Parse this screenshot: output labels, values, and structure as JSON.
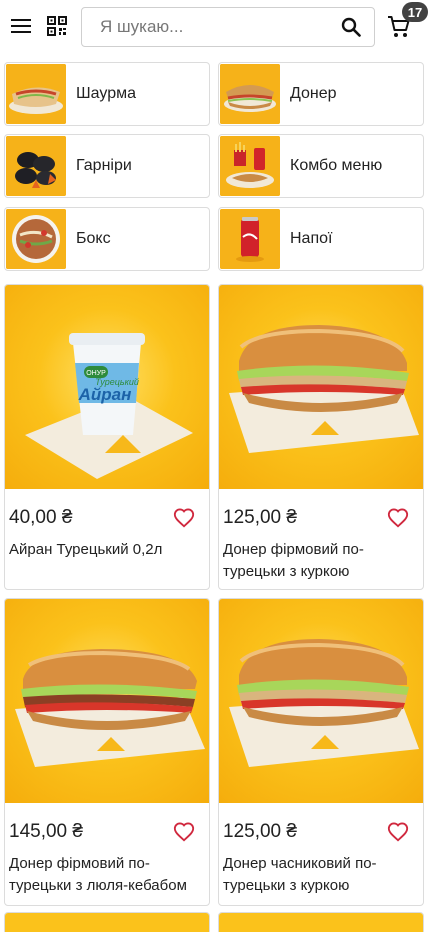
{
  "header": {
    "menu_icon": "menu-icon",
    "qr_icon": "qr-code-icon",
    "search_placeholder": "Я шукаю...",
    "search_icon": "search-icon",
    "cart_icon": "cart-icon",
    "cart_count": "17"
  },
  "categories": [
    {
      "label": "Шаурма",
      "icon": "shawarma"
    },
    {
      "label": "Донер",
      "icon": "doner"
    },
    {
      "label": "Гарніри",
      "icon": "garnish"
    },
    {
      "label": "Комбо меню",
      "icon": "combo"
    },
    {
      "label": "Бокс",
      "icon": "box"
    },
    {
      "label": "Напої",
      "icon": "drink"
    }
  ],
  "products": [
    {
      "price": "40,00 ₴",
      "name": "Айран Турецький 0,2л",
      "image": "ayran-cup",
      "cup_brand": "ОНУР",
      "cup_label": "Турецький",
      "cup_title": "Айран"
    },
    {
      "price": "125,00 ₴",
      "name": "Донер фірмовий по-турецьки з куркою",
      "image": "doner-sandwich"
    },
    {
      "price": "145,00 ₴",
      "name": "Донер фірмовий по-турецьки з люля-кебабом",
      "image": "doner-sandwich-kebab"
    },
    {
      "price": "125,00 ₴",
      "name": "Донер часниковий по-турецьки з куркою",
      "image": "doner-sandwich"
    }
  ],
  "colors": {
    "accent": "#f7b81a",
    "badge": "#424242",
    "favorite": "#d0283e"
  }
}
